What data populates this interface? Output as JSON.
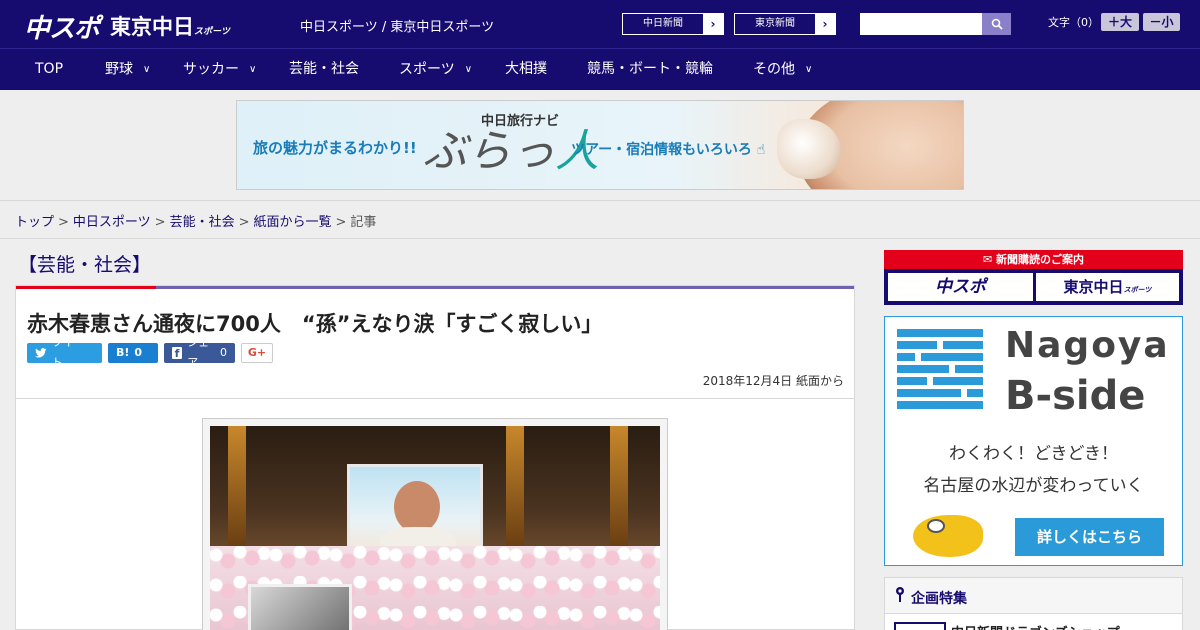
{
  "header": {
    "logo_chuspo": "中スポ",
    "logo_tokyo": "東京中日",
    "logo_tokyo_small": "スポーツ",
    "site_title": "中日スポーツ / 東京中日スポーツ",
    "links": [
      {
        "label": "中日新聞"
      },
      {
        "label": "東京新聞"
      }
    ],
    "search": {
      "placeholder": ""
    },
    "font_size": {
      "label": "文字（0）",
      "plus": "＋大",
      "minus": "－小"
    }
  },
  "nav": {
    "items": [
      {
        "label": "TOP",
        "dropdown": false
      },
      {
        "label": "野球",
        "dropdown": true
      },
      {
        "label": "サッカー",
        "dropdown": true
      },
      {
        "label": "芸能・社会",
        "dropdown": false
      },
      {
        "label": "スポーツ",
        "dropdown": true
      },
      {
        "label": "大相撲",
        "dropdown": false
      },
      {
        "label": "競馬・ボート・競輪",
        "dropdown": false
      },
      {
        "label": "その他",
        "dropdown": true
      }
    ]
  },
  "ad": {
    "copy": "旅の魅力がまるわかり!!",
    "navi": "中日旅行ナビ",
    "logo_a": "ぶらっ",
    "logo_b": "人",
    "tour": "ツアー・宿泊情報もいろいろ"
  },
  "breadcrumb": {
    "items": [
      "トップ",
      "中日スポーツ",
      "芸能・社会",
      "紙面から一覧"
    ],
    "current": "記事",
    "separator": ">"
  },
  "article": {
    "category": "【芸能・社会】",
    "headline": "赤木春恵さん通夜に700人　“孫”えなり涙「すごく寂しい」",
    "share": {
      "tweet": "ツイート",
      "hatena": "B!",
      "hatena_count": "0",
      "facebook": "シェア",
      "facebook_count": "0",
      "gplus": "G+"
    },
    "dateline": "2018年12月4日 紙面から"
  },
  "sidebar": {
    "subscribe": {
      "strip": "新聞購読のご案内",
      "chuspo": "中スポ",
      "tokyo": "東京中日",
      "tokyo_small": "スポーツ"
    },
    "bside": {
      "title1": "Nagoya",
      "title2": "B-side",
      "text1": "わくわく！どきどき！",
      "text2": "名古屋の水辺が変わっていく",
      "cta": "詳しくはこちら"
    },
    "feature": {
      "title": "企画特集",
      "item": "中日新聞ドラゴンズショップ"
    }
  },
  "colors": {
    "brand_navy": "#160b6e",
    "accent_red": "#e2001a",
    "bside_blue": "#2b9ad8"
  }
}
